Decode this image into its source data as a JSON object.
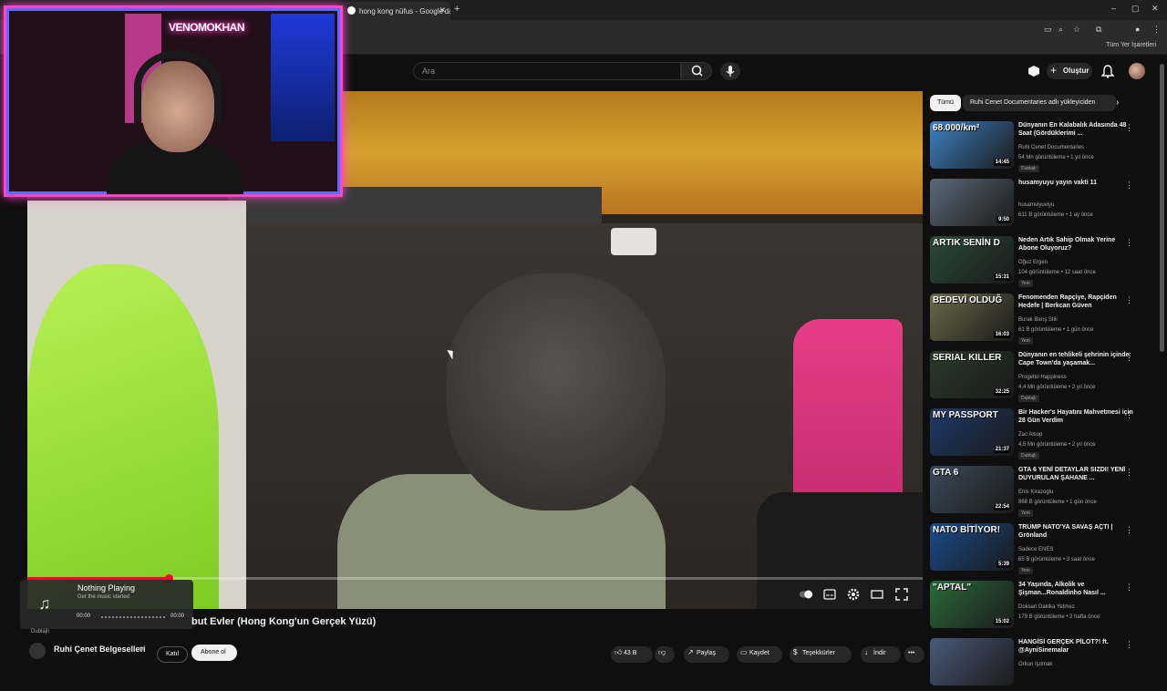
{
  "browser": {
    "tab_title": "hong kong nüfus - Google'da ...",
    "tab_close": "✕",
    "new_tab": "+",
    "win_min": "–",
    "win_max": "▢",
    "win_close": "✕",
    "bookmarks_label": "Tüm Yer İşaretleri"
  },
  "youtube_header": {
    "search_placeholder": "Ara",
    "create_label": "Oluştur",
    "create_plus": "+"
  },
  "webcam": {
    "sign_text": "VENOMOKHAN"
  },
  "player": {
    "progress_fraction": 0.158
  },
  "music_toast": {
    "title": "Nothing Playing",
    "subtitle": "Get the music started",
    "time_left": "00:00",
    "time_right": "00:00",
    "note_icon": "♫"
  },
  "video": {
    "title_visible": "but Evler (Hong Kong'un Gerçek Yüzü)",
    "dublaj_small": "Dublajlı",
    "channel_name": "Ruhi Çenet Belgeselleri",
    "verified": "⊛",
    "join_label": "Katıl",
    "subscribe_label": "Abone ol",
    "actions": {
      "like": "43 B",
      "share": "Paylaş",
      "save": "Kaydet",
      "thanks": "Teşekkürler",
      "download": "İndir",
      "more": "•••"
    }
  },
  "sidebar": {
    "chips": [
      "Tümü",
      "Ruhi Cenet Documentaries adlı yükleyiciden"
    ],
    "chip_next": "›",
    "items": [
      {
        "title": "Dünyanın En Kalabalık Adasında 48 Saat (Gördüklerimi ...",
        "channel": "Ruhi Cenet Documentaries",
        "meta": "54 Mn görüntüleme • 1 yıl önce",
        "badge": "Dublajlı",
        "duration": "14:45",
        "thumb_text": "68.000/km²",
        "thumb_color": "#3e82c4"
      },
      {
        "title": "husamyuyu yayın vakti 11",
        "channel": "husamviyuviyu",
        "meta": "611 B görüntüleme • 1 ay önce",
        "badge": "",
        "duration": "9:50",
        "thumb_text": "",
        "thumb_color": "#5a6a7a"
      },
      {
        "title": "Neden Artık Sahip Olmak Yerine Abone Oluyoruz?",
        "channel": "Oğuz Ergen",
        "meta": "104 görüntüleme • 12 saat önce",
        "badge": "Yeni",
        "duration": "15:31",
        "thumb_text": "ARTIK SENİN D",
        "thumb_color": "#2a4a3a"
      },
      {
        "title": "Fenomenden Rapçiye, Rapçiden Hedefe | Berkcan Güven",
        "channel": "Burak Barış Stili",
        "meta": "61 B görüntüleme • 1 gün önce",
        "badge": "Yeni",
        "duration": "16:03",
        "thumb_text": "BEDEVİ OLDUĞ",
        "thumb_color": "#6a6a4a"
      },
      {
        "title": "Dünyanın en tehlikeli şehrinin içinde: Cape Town'da yaşamak...",
        "channel": "Progetto Happiness",
        "meta": "4,4 Mn görüntüleme • 2 yıl önce",
        "badge": "Dublajlı",
        "duration": "32:25",
        "thumb_text": "SERIAL   KILLER",
        "thumb_color": "#2a3a2a"
      },
      {
        "title": "Bir Hacker's Hayatını Mahvetmesi için 28 Gün Verdim",
        "channel": "Zac Alsop",
        "meta": "4,5 Mn görüntüleme • 2 yıl önce",
        "badge": "Dublajlı",
        "duration": "21:37",
        "thumb_text": "MY PASSPORT",
        "thumb_color": "#1e3a6a"
      },
      {
        "title": "GTA 6 YENİ DETAYLAR SIZDI! YENİ DUYURULAN ŞAHANE ...",
        "channel": "Enis Kirazoglu",
        "meta": "868 B görüntüleme • 1 gün önce",
        "badge": "Yeni",
        "duration": "22:54",
        "thumb_text": "GTA 6",
        "thumb_color": "#3a4a5a"
      },
      {
        "title": "TRUMP NATO'YA SAVAŞ AÇTI | Grönland",
        "channel": "Sadece ENES",
        "meta": "65 B görüntüleme • 3 saat önce",
        "badge": "Yeni",
        "duration": "5:39",
        "thumb_text": "NATO BİTİYOR!",
        "thumb_color": "#1a4a8a"
      },
      {
        "title": "34 Yaşında, Alkolik ve Şişman...Ronaldinho Nasıl ...",
        "channel": "Doksan Dakika Yetmez",
        "meta": "179 B görüntüleme • 2 hafta önce",
        "badge": "",
        "duration": "15:02",
        "thumb_text": "\"APTAL\"",
        "thumb_color": "#2a6a3a"
      },
      {
        "title": "HANGİSİ GERÇEK PİLOT?! ft. @AyniSinemalar",
        "channel": "Orkun Işıtmak",
        "meta": "",
        "badge": "",
        "duration": "",
        "thumb_text": "",
        "thumb_color": "#4a5a7a"
      }
    ]
  }
}
